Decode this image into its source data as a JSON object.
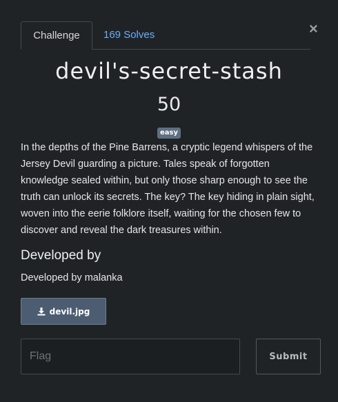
{
  "tabs": {
    "challenge_label": "Challenge",
    "solves_label": "169 Solves"
  },
  "close_glyph": "×",
  "challenge": {
    "name": "devil's-secret-stash",
    "points": "50",
    "difficulty": "easy",
    "description": "In the depths of the Pine Barrens, a cryptic legend whispers of the Jersey Devil guarding a picture. Tales speak of forgotten knowledge sealed within, but only those sharp enough to see the truth can unlock its secrets. The key? The key hiding in plain sight, woven into the eerie folklore itself, waiting for the chosen few to discover and reveal the dark treasures within.",
    "developer_heading": "Developed by",
    "developer_text": "Developed by malanka",
    "file_name": "devil.jpg"
  },
  "form": {
    "flag_placeholder": "Flag",
    "flag_value": "",
    "submit_label": "Submit"
  },
  "colors": {
    "background": "#202326",
    "link": "#6ab0f5",
    "badge": "#5e6f80",
    "file_button": "#4c5d72"
  },
  "icons": {
    "close": "close-icon",
    "file": "download-icon"
  }
}
